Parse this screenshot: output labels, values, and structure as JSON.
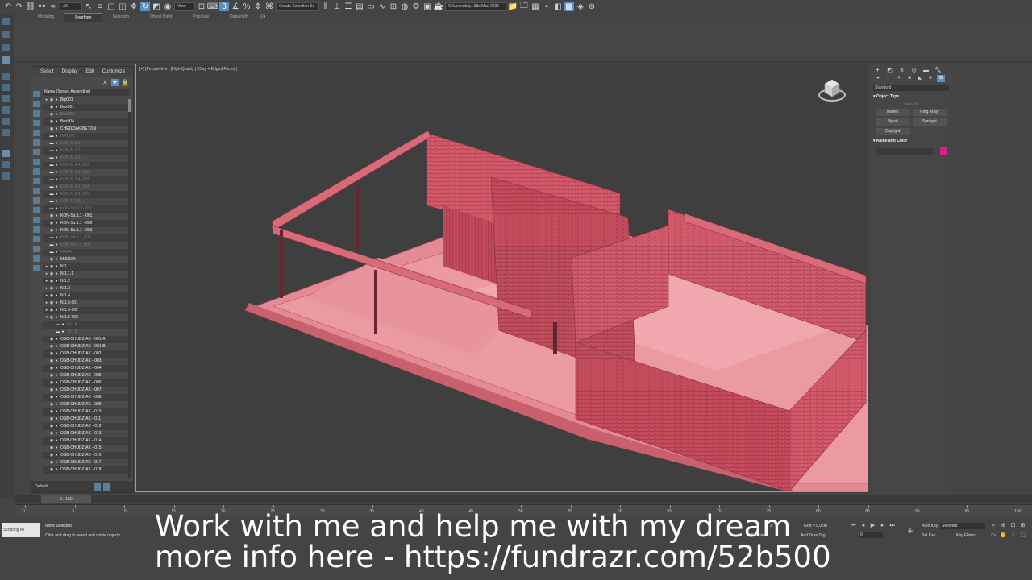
{
  "toolbar": {
    "filter_dropdown": "All",
    "view_dropdown": "View",
    "selection_set_placeholder": "Create Selection Se",
    "project_path": "C:\\Users\\bej...3ds Max 2025"
  },
  "ribbon": {
    "tabs": [
      "Modeling",
      "Freeform",
      "Selection",
      "Object Paint",
      "Populate",
      "Datasmith"
    ],
    "active_tab": "Freeform"
  },
  "scene_explorer": {
    "menu": [
      "Select",
      "Display",
      "Edit",
      "Customize"
    ],
    "column_header": "Name (Sorted Ascending)",
    "layer_label": "Default",
    "rows": [
      {
        "label": "Bip001",
        "style": "normal",
        "depth": 1,
        "arrow": "▸"
      },
      {
        "label": "Box001",
        "style": "normal",
        "depth": 1,
        "arrow": ""
      },
      {
        "label": "Box003",
        "style": "dim",
        "depth": 1,
        "arrow": ""
      },
      {
        "label": "Box004",
        "style": "normal",
        "depth": 1,
        "arrow": ""
      },
      {
        "label": "CHEDZIAK-BETON",
        "style": "normal",
        "depth": 1,
        "arrow": ""
      },
      {
        "label": "GRUNT",
        "style": "hid",
        "depth": 1,
        "arrow": ""
      },
      {
        "label": "KON-N.1.1",
        "style": "hid",
        "depth": 1,
        "arrow": ""
      },
      {
        "label": "KON-N.1.2",
        "style": "hid",
        "depth": 1,
        "arrow": ""
      },
      {
        "label": "KON-N.1.3",
        "style": "hid",
        "depth": 1,
        "arrow": ""
      },
      {
        "label": "KON-N.1.4_001",
        "style": "hid",
        "depth": 1,
        "arrow": ""
      },
      {
        "label": "KON-N.1.4_002",
        "style": "hid",
        "depth": 1,
        "arrow": ""
      },
      {
        "label": "KON-N.1.4_003",
        "style": "hid",
        "depth": 1,
        "arrow": ""
      },
      {
        "label": "KON-N.1.4_004",
        "style": "hid",
        "depth": 1,
        "arrow": ""
      },
      {
        "label": "KON-N.1.4_005",
        "style": "hid",
        "depth": 1,
        "arrow": ""
      },
      {
        "label": "KON-N.1.5",
        "style": "hid",
        "depth": 1,
        "arrow": ""
      },
      {
        "label": "KON-Szt.2.1_001",
        "style": "hid",
        "depth": 1,
        "arrow": ""
      },
      {
        "label": "KON-Ss.1.1 - 001",
        "style": "normal",
        "depth": 1,
        "arrow": ""
      },
      {
        "label": "KON-Ss.1.1 - 002",
        "style": "normal",
        "depth": 1,
        "arrow": ""
      },
      {
        "label": "KON-Ss.1.1 - 003",
        "style": "normal",
        "depth": 1,
        "arrow": ""
      },
      {
        "label": "KON-Ss.2.1_001",
        "style": "hid",
        "depth": 1,
        "arrow": ""
      },
      {
        "label": "KON-Ss.2.1_002",
        "style": "hid",
        "depth": 1,
        "arrow": ""
      },
      {
        "label": "MAPA",
        "style": "hid",
        "depth": 1,
        "arrow": ""
      },
      {
        "label": "MISKKA",
        "style": "normal",
        "depth": 1,
        "arrow": ""
      },
      {
        "label": "N.1.1",
        "style": "normal",
        "depth": 1,
        "arrow": "▸"
      },
      {
        "label": "N.1.1.1",
        "style": "normal",
        "depth": 1,
        "arrow": "▸"
      },
      {
        "label": "N.1.2",
        "style": "normal",
        "depth": 1,
        "arrow": "▸"
      },
      {
        "label": "N.1.3",
        "style": "normal",
        "depth": 1,
        "arrow": "▸"
      },
      {
        "label": "N.1.4",
        "style": "normal",
        "depth": 1,
        "arrow": "▸"
      },
      {
        "label": "N.1.5-001",
        "style": "normal",
        "depth": 1,
        "arrow": "▸"
      },
      {
        "label": "N.1.5-002",
        "style": "normal",
        "depth": 1,
        "arrow": "▸"
      },
      {
        "label": "N.1.5-003",
        "style": "normal",
        "depth": 1,
        "arrow": "▾"
      },
      {
        "label": "Ot - A",
        "style": "hid",
        "depth": 2,
        "arrow": ""
      },
      {
        "label": "Ot - B",
        "style": "hid",
        "depth": 2,
        "arrow": ""
      },
      {
        "label": "OSB-CHUDZIAK - 001-A",
        "style": "normal",
        "depth": 1,
        "arrow": ""
      },
      {
        "label": "OSB-CHUDZIAK - 001-B",
        "style": "normal",
        "depth": 1,
        "arrow": ""
      },
      {
        "label": "OSB-CHUDZIAK - 002",
        "style": "normal",
        "depth": 1,
        "arrow": ""
      },
      {
        "label": "OSB-CHUDZIAK - 003",
        "style": "normal",
        "depth": 1,
        "arrow": ""
      },
      {
        "label": "OSB-CHUDZIAK - 004",
        "style": "normal",
        "depth": 1,
        "arrow": ""
      },
      {
        "label": "OSB-CHUDZIAK - 005",
        "style": "normal",
        "depth": 1,
        "arrow": ""
      },
      {
        "label": "OSB-CHUDZIAK - 006",
        "style": "normal",
        "depth": 1,
        "arrow": ""
      },
      {
        "label": "OSB-CHUDZIAK - 007",
        "style": "normal",
        "depth": 1,
        "arrow": ""
      },
      {
        "label": "OSB-CHUDZIAK - 008",
        "style": "normal",
        "depth": 1,
        "arrow": ""
      },
      {
        "label": "OSB-CHUDZIAK - 009",
        "style": "normal",
        "depth": 1,
        "arrow": ""
      },
      {
        "label": "OSB-CHUDZIAK - 010",
        "style": "normal",
        "depth": 1,
        "arrow": ""
      },
      {
        "label": "OSB-CHUDZIAK - 011",
        "style": "normal",
        "depth": 1,
        "arrow": ""
      },
      {
        "label": "OSB-CHUDZIAK - 012",
        "style": "normal",
        "depth": 1,
        "arrow": ""
      },
      {
        "label": "OSB-CHUDZIAK - 013",
        "style": "normal",
        "depth": 1,
        "arrow": ""
      },
      {
        "label": "OSB-CHUDZIAK - 014",
        "style": "normal",
        "depth": 1,
        "arrow": ""
      },
      {
        "label": "OSB-CHUDZIAK - 015",
        "style": "normal",
        "depth": 1,
        "arrow": ""
      },
      {
        "label": "OSB-CHUDZIAK - 016",
        "style": "normal",
        "depth": 1,
        "arrow": ""
      },
      {
        "label": "OSB-CHUDZIAK - 017",
        "style": "normal",
        "depth": 1,
        "arrow": ""
      },
      {
        "label": "OSB-CHUDZIAK - 018",
        "style": "normal",
        "depth": 1,
        "arrow": ""
      }
    ]
  },
  "viewport": {
    "label": "[+] [Perspective ] [High Quality ] [Clay + Edged Faces ]",
    "model_color": "#d96a78",
    "border_color": "#a6a74a"
  },
  "command_panel": {
    "category_dropdown": "Standard",
    "object_type_title": "Object Type",
    "autogrid_label": "AutoGrid",
    "buttons": [
      "Bones",
      "Ring Array",
      "Biped",
      "Sunlight",
      "Daylight"
    ],
    "name_color_title": "Name and Color",
    "object_color": "#e31c87"
  },
  "timeline": {
    "frame_readout": "0 / 100",
    "ticks": [
      "0",
      "5",
      "10",
      "15",
      "20",
      "25",
      "30",
      "35",
      "40",
      "45",
      "50",
      "55",
      "60",
      "65",
      "70",
      "75",
      "80",
      "85",
      "90",
      "95",
      "100"
    ]
  },
  "status": {
    "maxscript_label": "Scripting Mi",
    "selection_status": "None Selected",
    "prompt": "Click and drag to select and rotate objects",
    "z_label": "Z:",
    "grid_label": "Grid = 0,0cm",
    "enabled_label": "Enabled:",
    "add_time_tag": "Add Time Tag",
    "frame_value": "0",
    "auto_key": "Auto Key",
    "set_key": "Set Key",
    "selected_dropdown": "Selected",
    "key_filters": "Key Filters..."
  },
  "caption": {
    "line1": "Work with me and help me with my dream",
    "line2": "more info here - https://fundrazr.com/52b500"
  }
}
